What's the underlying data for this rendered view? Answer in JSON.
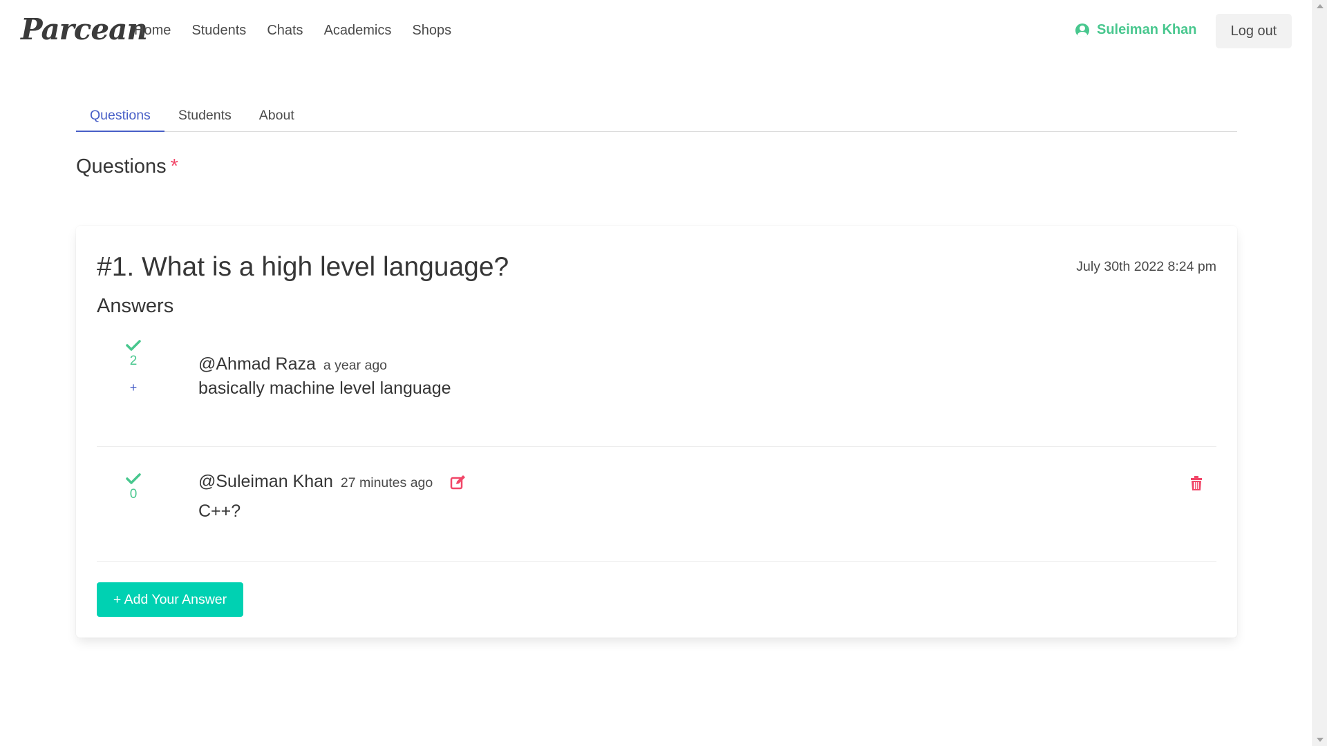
{
  "app": {
    "logo": "Parcean"
  },
  "nav": {
    "links": [
      "Home",
      "Students",
      "Chats",
      "Academics",
      "Shops"
    ],
    "user_name": "Suleiman Khan",
    "logout_label": "Log out"
  },
  "tabs": [
    "Questions",
    "Students",
    "About"
  ],
  "section": {
    "title": "Questions",
    "star": "*"
  },
  "question": {
    "title": "#1. What is a high level language?",
    "date": "July 30th 2022 8:24 pm",
    "answers_title": "Answers",
    "answers": [
      {
        "author": "@Ahmad Raza",
        "time": "a year ago",
        "text": "basically machine level language",
        "votes": "2",
        "upvote_label": "+"
      },
      {
        "author": "@Suleiman Khan",
        "time": "27 minutes ago",
        "text": "C++?",
        "votes": "0"
      }
    ],
    "add_answer_label": "+ Add Your Answer"
  },
  "colors": {
    "accent_green": "#48c78e",
    "link_blue": "#485fc7",
    "danger_red": "#f14668",
    "primary_teal": "#00d1b2"
  },
  "icons": [
    "user-circle-icon",
    "check-icon",
    "edit-icon",
    "trash-icon"
  ]
}
